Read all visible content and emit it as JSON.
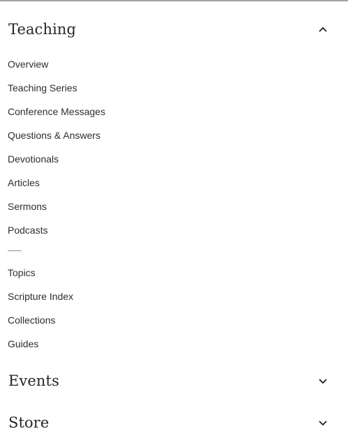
{
  "teaching": {
    "title": "Teaching",
    "primary_items": [
      "Overview",
      "Teaching Series",
      "Conference Messages",
      "Questions & Answers",
      "Devotionals",
      "Articles",
      "Sermons",
      "Podcasts"
    ],
    "secondary_items": [
      "Topics",
      "Scripture Index",
      "Collections",
      "Guides"
    ],
    "expanded": true,
    "toggle_icon": "chevron-up-icon"
  },
  "events": {
    "title": "Events",
    "expanded": false,
    "toggle_icon": "chevron-down-icon"
  },
  "store": {
    "title": "Store",
    "expanded": false,
    "toggle_icon": "chevron-down-icon"
  },
  "colors": {
    "top_rule": "#9aa89a",
    "divider_accent": "#8a9a5b",
    "heading_text": "#262626",
    "link_text": "#2e2e2e"
  }
}
